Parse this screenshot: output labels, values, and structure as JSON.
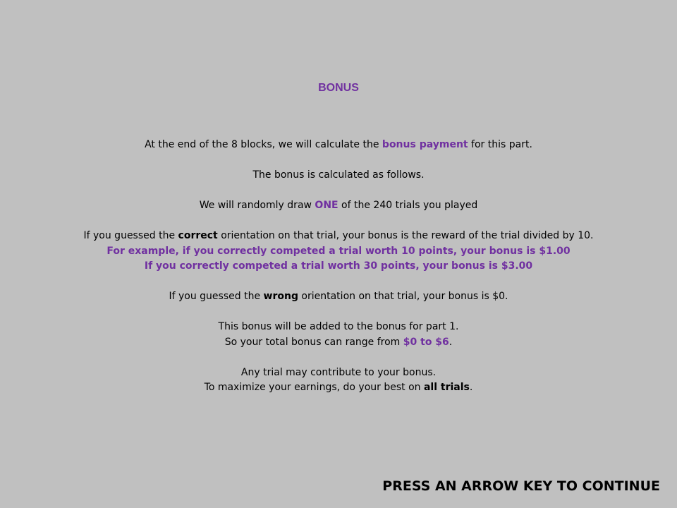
{
  "title": "BONUS",
  "lines": {
    "l1_a": "At the end of the 8 blocks, we will calculate the ",
    "l1_b": "bonus payment",
    "l1_c": " for this part.",
    "l2": "The bonus is calculated as follows.",
    "l3_a": "We will randomly draw ",
    "l3_b": "ONE",
    "l3_c": " of the 240 trials you played",
    "l4_a": "If you guessed the ",
    "l4_b": "correct",
    "l4_c": " orientation on that trial, your bonus is the reward of the trial divided by 10.",
    "l5": "For example, if you correctly competed a trial worth 10 points, your bonus is $1.00",
    "l6": "If you correctly competed a trial worth 30 points, your bonus is $3.00",
    "l7_a": "If you guessed the ",
    "l7_b": "wrong",
    "l7_c": " orientation on that trial, your bonus is $0.",
    "l8": "This bonus will be added to the bonus for part 1.",
    "l9_a": "So your total bonus can range from ",
    "l9_b": "$0 to $6",
    "l9_c": ".",
    "l10": "Any trial may contribute to your bonus.",
    "l11_a": "To maximize your earnings, do your best on ",
    "l11_b": "all trials",
    "l11_c": "."
  },
  "continue_prompt": "PRESS AN ARROW KEY TO CONTINUE",
  "colors": {
    "background": "#c0c0c0",
    "accent": "#7030a0"
  }
}
